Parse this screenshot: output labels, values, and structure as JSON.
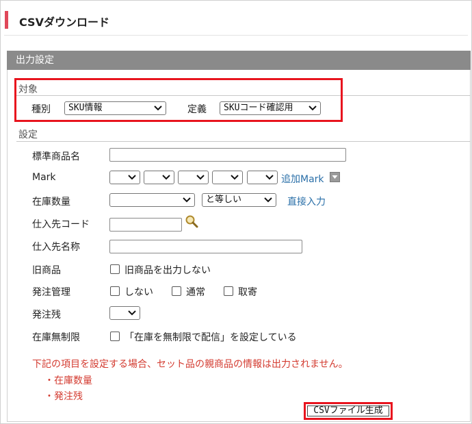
{
  "page": {
    "title": "CSVダウンロード"
  },
  "panel": {
    "header": "出力設定"
  },
  "target": {
    "section_title": "対象",
    "type_label": "種別",
    "type_value": "SKU情報",
    "definition_label": "定義",
    "definition_value": "SKUコード確認用"
  },
  "settings": {
    "section_title": "設定",
    "product_name_label": "標準商品名",
    "mark_label": "Mark",
    "add_mark_link": "追加Mark",
    "stock_qty_label": "在庫数量",
    "stock_qty_operator": "と等しい",
    "direct_input_link": "直接入力",
    "supplier_code_label": "仕入先コード",
    "supplier_name_label": "仕入先名称",
    "old_product_label": "旧商品",
    "old_product_option": "旧商品を出力しない",
    "order_mgmt_label": "発注管理",
    "order_mgmt_options": [
      "しない",
      "通常",
      "取寄"
    ],
    "order_remaining_label": "発注残",
    "unlimited_stock_label": "在庫無制限",
    "unlimited_stock_option": "「在庫を無制限で配信」を設定している"
  },
  "notice": {
    "message": "下記の項目を設定する場合、セット品の親商品の情報は出力されません。",
    "items": [
      "・在庫数量",
      "・発注残"
    ]
  },
  "actions": {
    "generate_label": "CSVファイル生成"
  },
  "colors": {
    "accent": "#e0485a",
    "highlight": "#e8141e",
    "link": "#2a6fa8",
    "warning": "#d33a2f",
    "panel_header": "#8a8a8a"
  }
}
